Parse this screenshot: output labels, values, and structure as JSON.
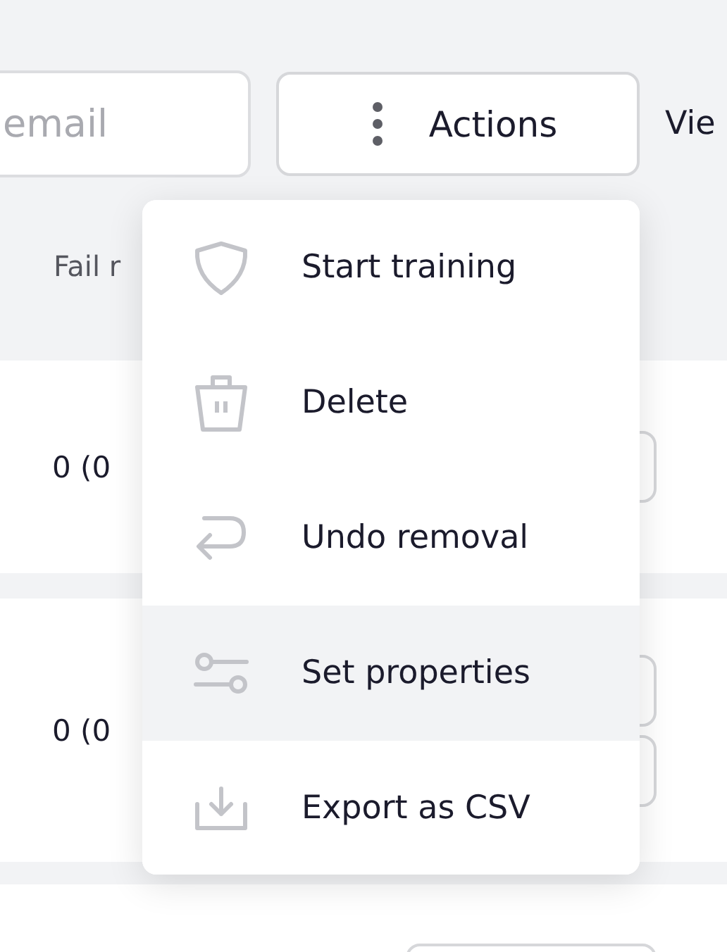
{
  "toolbar": {
    "search": {
      "placeholder": "email"
    },
    "actions_button": {
      "label": "Actions"
    },
    "view_label": "Vie"
  },
  "table": {
    "columns": [
      "Fail r"
    ],
    "rows": [
      {
        "cells": [
          "0 (0"
        ]
      },
      {
        "cells": [
          "0 (0"
        ]
      }
    ]
  },
  "menu": {
    "items": [
      {
        "label": "Start training",
        "kind": "shield",
        "selected": false
      },
      {
        "label": "Delete",
        "kind": "trash",
        "selected": false
      },
      {
        "label": "Undo removal",
        "kind": "undo",
        "selected": false
      },
      {
        "label": "Set properties",
        "kind": "sliders",
        "selected": true
      },
      {
        "label": "Export as CSV",
        "kind": "download",
        "selected": false
      }
    ]
  }
}
